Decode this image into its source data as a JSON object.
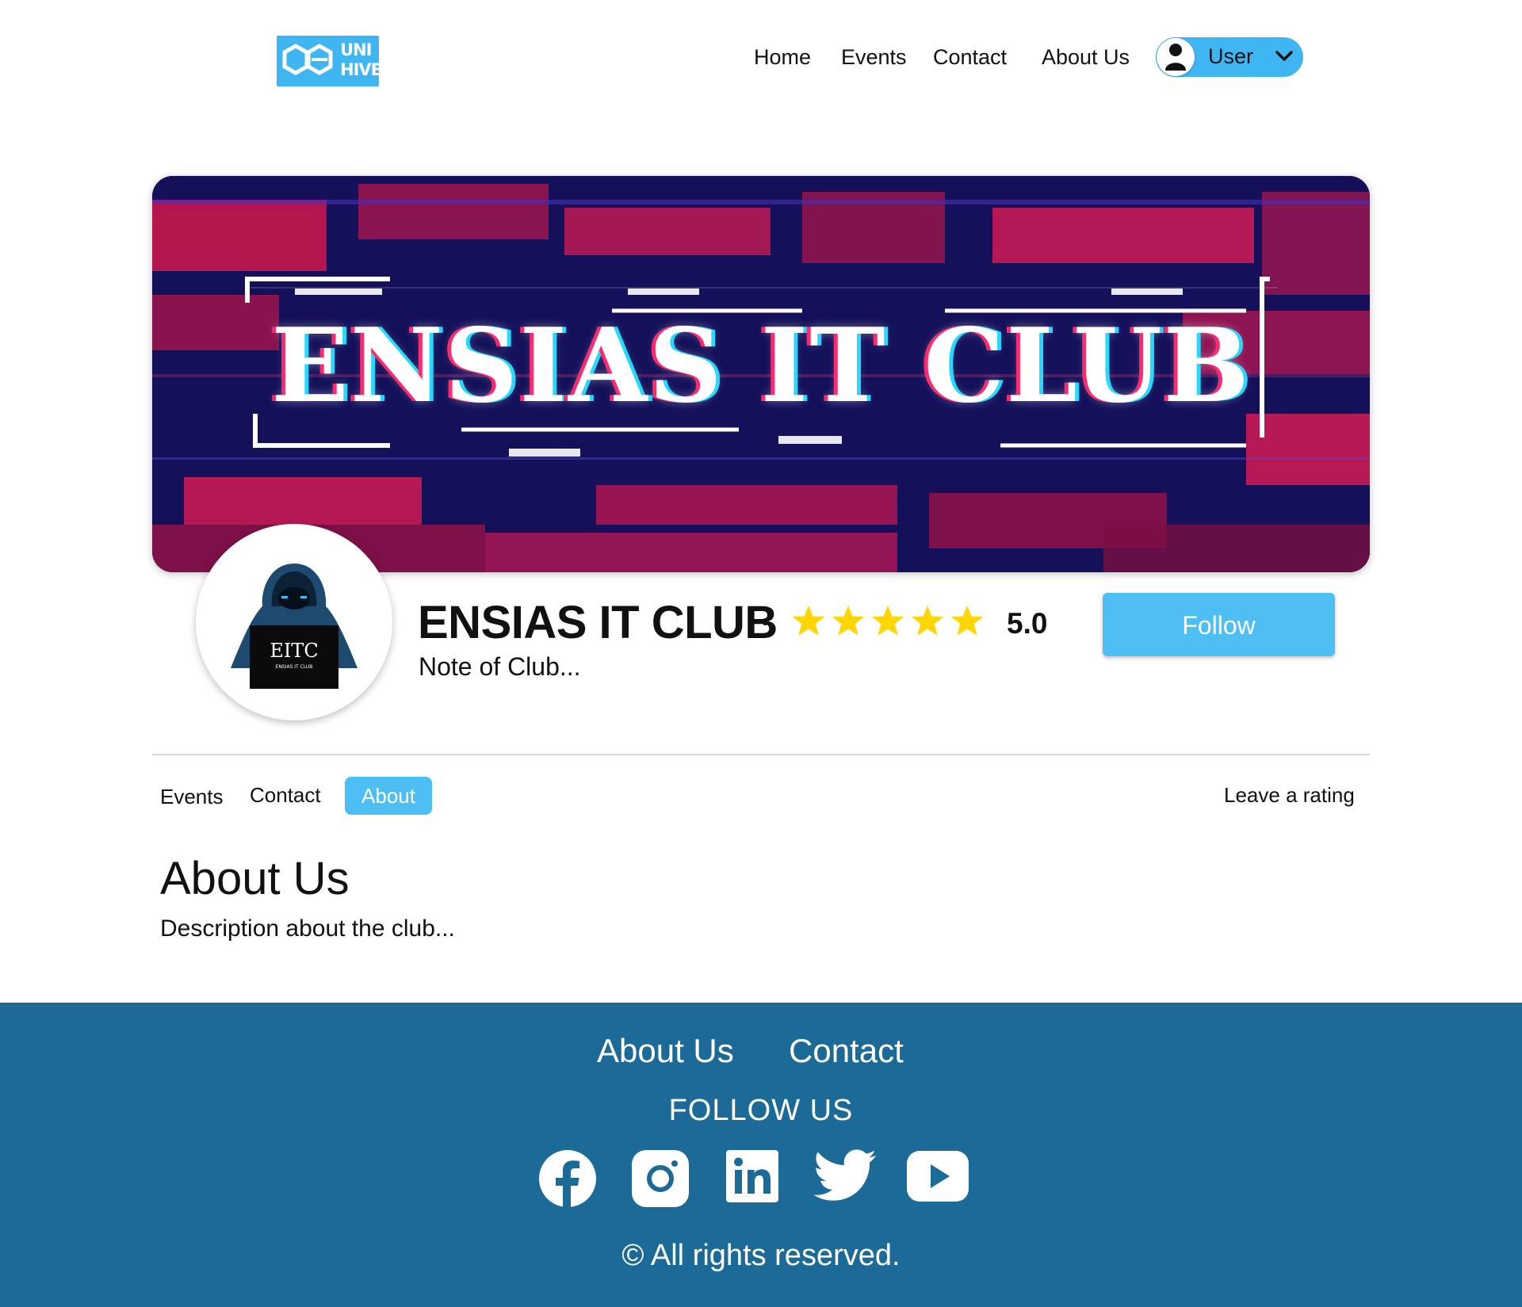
{
  "header": {
    "logo_text_line1": "UNI",
    "logo_text_line2": "HIVE",
    "nav": [
      "Home",
      "Events",
      "Contact",
      "About Us"
    ],
    "user_label": "User"
  },
  "banner": {
    "title": "ENSIAS IT CLUB"
  },
  "club": {
    "avatar_text": "EITC",
    "avatar_subtext": "ENSIAS IT CLUB",
    "name": "ENSIAS IT CLUB",
    "rating_stars": 5,
    "rating_value": "5.0",
    "note": "Note of Club...",
    "follow_label": "Follow"
  },
  "tabs": {
    "items": [
      "Events",
      "Contact",
      "About"
    ],
    "active": "About",
    "leave_rating": "Leave a rating"
  },
  "about": {
    "heading": "About Us",
    "description": "Description about the club..."
  },
  "footer": {
    "links": [
      "About Us",
      "Contact"
    ],
    "follow_us": "FOLLOW US",
    "socials": [
      "facebook-icon",
      "instagram-icon",
      "linkedin-icon",
      "twitter-icon",
      "youtube-icon"
    ],
    "copyright": "© All rights reserved."
  },
  "colors": {
    "accent": "#4dbff5",
    "footer": "#1b6a97",
    "star": "#ffd600",
    "banner_dark": "#14105a",
    "banner_red": "#e0185a"
  }
}
